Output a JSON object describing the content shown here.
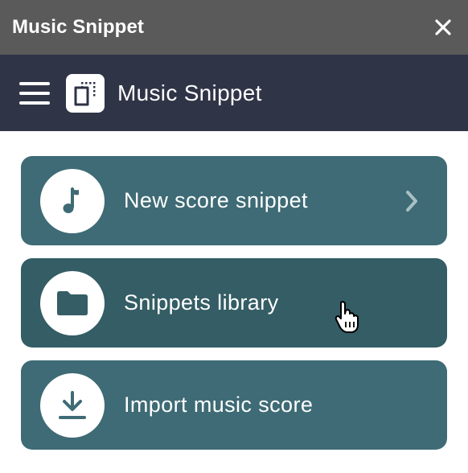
{
  "window": {
    "title": "Music Snippet",
    "close_icon": "close-icon"
  },
  "header": {
    "menu_icon": "hamburger-menu-icon",
    "logo_icon": "app-logo-icon",
    "title": "Music Snippet",
    "background": "#303447"
  },
  "menu": {
    "items": [
      {
        "label": "New score snippet",
        "icon": "music-note-icon",
        "trailing_icon": "chevron-right-icon"
      },
      {
        "label": "Snippets library",
        "icon": "folder-icon",
        "state": "hover"
      },
      {
        "label": "Import music score",
        "icon": "download-icon"
      }
    ],
    "item_color": "#3e6b75",
    "item_hover_color": "#345d65"
  },
  "cursor": {
    "type": "hand-pointer"
  }
}
